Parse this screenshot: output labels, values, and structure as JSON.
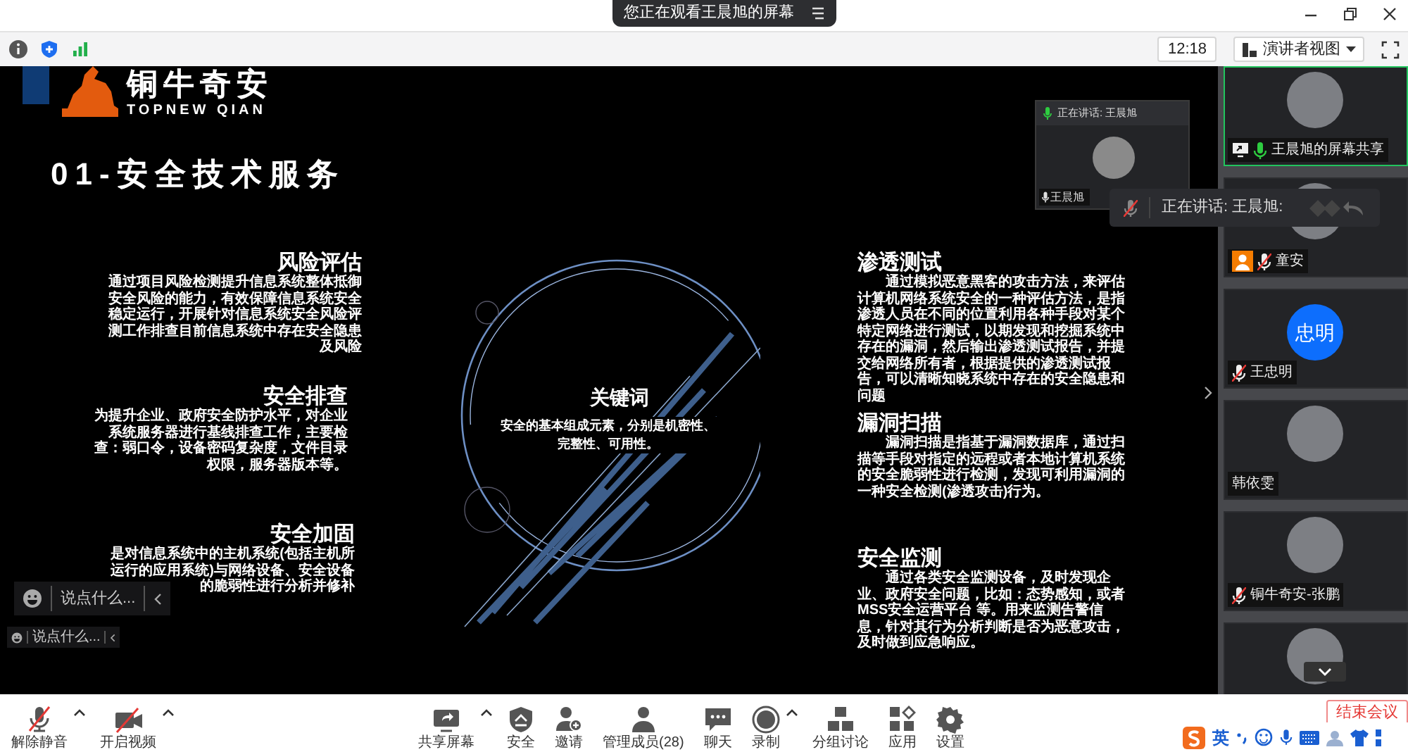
{
  "window": {
    "banner": "您正在观看王晨旭的屏幕",
    "time": "12:18",
    "view_menu": "演讲者视图"
  },
  "slide": {
    "logo_cn": "铜牛奇安",
    "logo_en": "TOPNEW QIAN",
    "title": "01-安全技术服务",
    "left_sections": [
      {
        "title": "风险评估",
        "text": "通过项目风险检测提升信息系统整体抵御安全风险的能力，有效保障信息系统安全稳定运行，开展针对信息系统安全风险评测工作排查目前信息系统中存在安全隐患及风险"
      },
      {
        "title": "安全排查",
        "text": "为提升企业、政府安全防护水平，对企业系统服务器进行基线排查工作，主要检查：弱口令，设备密码复杂度，文件目录权限，服务器版本等。"
      },
      {
        "title": "安全加固",
        "text": "是对信息系统中的主机系统(包括主机所运行的应用系统)与网络设备、安全设备的脆弱性进行分析并修补"
      }
    ],
    "right_sections": [
      {
        "title": "渗透测试",
        "text": "通过模拟恶意黑客的攻击方法，来评估计算机网络系统安全的一种评估方法，是指渗透人员在不同的位置利用各种手段对某个特定网络进行测试，以期发现和挖掘系统中存在的漏洞，然后输出渗透测试报告，并提交给网络所有者，根据提供的渗透测试报告，可以清晰知晓系统中存在的安全隐患和问题"
      },
      {
        "title": "漏洞扫描",
        "text": "漏洞扫描是指基于漏洞数据库，通过扫描等手段对指定的远程或者本地计算机系统的安全脆弱性进行检测，发现可利用漏洞的一种安全检测(渗透攻击)行为。"
      },
      {
        "title": "安全监测",
        "text": "通过各类安全监测设备，及时发现企业、政府安全问题，比如：态势感知，或者MSS安全运营平台 等。用来监测告警信息，针对其行为分析判断是否为恶意攻击，及时做到应急响应。"
      }
    ],
    "keyword": {
      "title": "关键词",
      "text": "安全的基本组成元素，分别是机密性、完整性、可用性。"
    }
  },
  "speaker_window": {
    "header": "正在讲话: 王晨旭",
    "name": "王晨旭"
  },
  "speaking_toast": "正在讲话: 王晨旭:",
  "chat_inputs": [
    {
      "placeholder": "说点什么..."
    },
    {
      "placeholder": "说点什么..."
    }
  ],
  "participants": [
    {
      "name": "王晨旭的屏幕共享",
      "kind": "photo",
      "speaking": true,
      "muted": false,
      "sharing": true,
      "host": false,
      "selected": true
    },
    {
      "name": "童安",
      "kind": "photo",
      "speaking": false,
      "muted": true,
      "sharing": false,
      "host": true,
      "selected": false
    },
    {
      "name": "王忠明",
      "kind": "initials",
      "initials": "忠明",
      "speaking": false,
      "muted": true,
      "sharing": false,
      "host": false,
      "selected": false
    },
    {
      "name": "韩依雯",
      "kind": "photo",
      "speaking": false,
      "muted": false,
      "sharing": false,
      "host": false,
      "selected": false
    },
    {
      "name": "铜牛奇安-张鹏",
      "kind": "photo",
      "speaking": false,
      "muted": true,
      "sharing": false,
      "host": false,
      "selected": false
    },
    {
      "kind": "photo",
      "selected": false
    }
  ],
  "toolbar": {
    "left": [
      {
        "kind": "mic-muted",
        "label": "解除静音",
        "menu": true
      },
      {
        "kind": "video-off",
        "label": "开启视频",
        "menu": true
      }
    ],
    "center": [
      {
        "kind": "share",
        "label": "共享屏幕",
        "menu": true
      },
      {
        "kind": "security",
        "label": "安全",
        "menu": false
      },
      {
        "kind": "invite",
        "label": "邀请",
        "menu": false
      },
      {
        "kind": "members",
        "label": "管理成员(28)",
        "menu": false
      },
      {
        "kind": "chat",
        "label": "聊天",
        "menu": false
      },
      {
        "kind": "record",
        "label": "录制",
        "menu": true
      },
      {
        "kind": "breakout",
        "label": "分组讨论",
        "menu": false
      },
      {
        "kind": "apps",
        "label": "应用",
        "menu": false
      },
      {
        "kind": "settings",
        "label": "设置",
        "menu": false
      }
    ],
    "end_button": "结束会议"
  },
  "ime": {
    "mode": "英"
  }
}
